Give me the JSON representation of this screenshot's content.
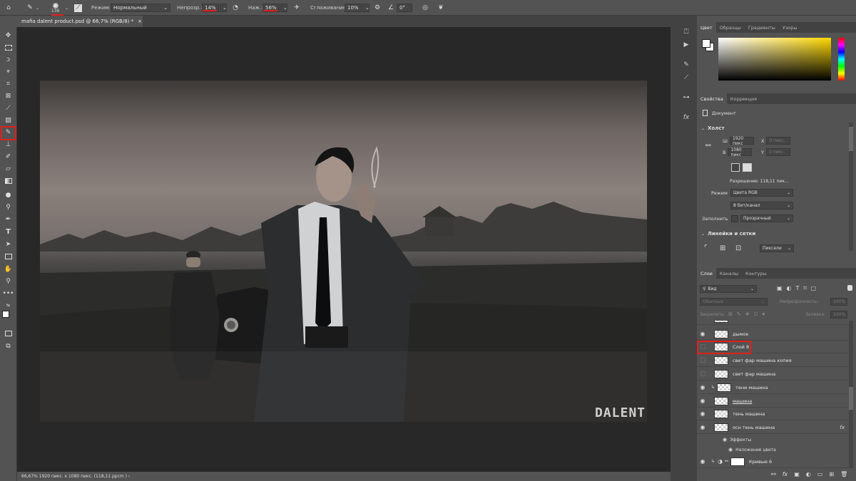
{
  "options_bar": {
    "brush_size": "136",
    "mode_label": "Режим:",
    "mode_value": "Нормальный",
    "opacity_label": "Непрозр.:",
    "opacity_value": "14%",
    "flow_label": "Наж.:",
    "flow_value": "56%",
    "smoothing_label": "Сглаживание:",
    "smoothing_value": "10%",
    "angle_value": "0°"
  },
  "document_tab": {
    "title": "mafia dalent product.psd @ 66,7% (RGB/8) *",
    "close": "×"
  },
  "status_bar": {
    "text": "66,67%   1920 пикс. x 1080 пикс. (118,11 ppcm )   ›"
  },
  "canvas": {
    "watermark": "DALENT"
  },
  "color_panel": {
    "tabs": [
      "Цвет",
      "Образцы",
      "Градиенты",
      "Узоры"
    ]
  },
  "properties_panel": {
    "tabs": [
      "Свойства",
      "Коррекция"
    ],
    "doc_label": "Документ",
    "canvas_section": "Холст",
    "w_label": "Ш",
    "w_value": "1920 пикс",
    "h_label": "В",
    "h_value": "1080 пикс",
    "x_label": "X",
    "x_value": "0 пикс.",
    "y_label": "Y",
    "y_value": "0 пикс.",
    "resolution": "Разрешение: 118,11 пик...",
    "mode_label": "Режим",
    "mode_value": "Цвета RGB",
    "depth_value": "8 бит/канал",
    "fill_label": "Заполнить",
    "fill_value": "Прозрачный",
    "rulers_section": "Линейки и сетки",
    "units_value": "Пиксели"
  },
  "layers_panel": {
    "tabs": [
      "Слои",
      "Каналы",
      "Контуры"
    ],
    "filter_value": "Вид",
    "blend_value": "Обычные",
    "opacity_label": "Непрозрачность:",
    "opacity_value": "100%",
    "lock_label": "Закрепить:",
    "fill_label": "Заливка:",
    "fill_value": "100%",
    "layers": [
      {
        "name": "дымок",
        "visible": true
      },
      {
        "name": "Слой 8",
        "visible": false
      },
      {
        "name": "свет фар машина копия",
        "visible": false
      },
      {
        "name": "свет фар машина",
        "visible": false
      },
      {
        "name": "тени машина",
        "visible": true
      },
      {
        "name": "машина",
        "visible": true
      },
      {
        "name": "тень машина",
        "visible": true
      },
      {
        "name": "осн тень машина",
        "visible": true
      }
    ],
    "effects_label": "Эффекты",
    "color_overlay_label": "Наложение цвета",
    "curves_name": "Кривые 6"
  }
}
